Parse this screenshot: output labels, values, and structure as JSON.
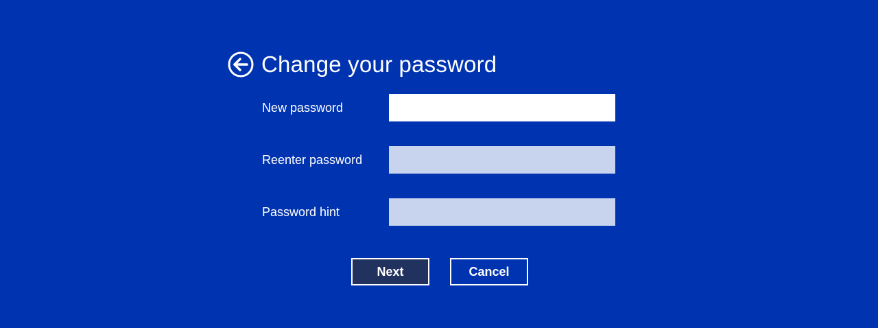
{
  "page": {
    "title": "Change your password",
    "back_icon": "back-arrow-circle-icon",
    "background_color": "#0033b0"
  },
  "form": {
    "fields": [
      {
        "label": "New password",
        "value": "",
        "type": "password",
        "state": "focused"
      },
      {
        "label": "Reenter password",
        "value": "",
        "type": "password",
        "state": "unfocused"
      },
      {
        "label": "Password hint",
        "value": "",
        "type": "text",
        "state": "unfocused"
      }
    ]
  },
  "actions": {
    "next_label": "Next",
    "cancel_label": "Cancel",
    "next_bg_color": "#22325e"
  }
}
